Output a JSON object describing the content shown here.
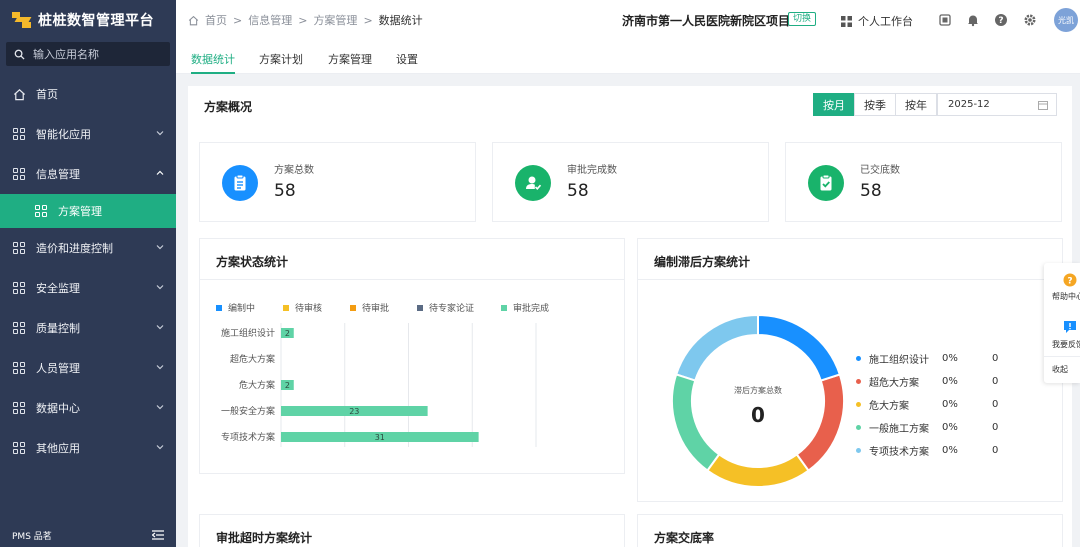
{
  "app": {
    "title": "桩桩数智管理平台",
    "footer_brand": "PMS 品茗"
  },
  "search": {
    "placeholder": "输入应用名称"
  },
  "sidebar": {
    "items": [
      {
        "label": "首页",
        "icon": "home-icon"
      },
      {
        "label": "智能化应用",
        "icon": "grid-icon"
      },
      {
        "label": "信息管理",
        "icon": "grid-icon"
      },
      {
        "label": "方案管理",
        "icon": "grid-icon"
      },
      {
        "label": "造价和进度控制",
        "icon": "grid-icon"
      },
      {
        "label": "安全监理",
        "icon": "grid-icon"
      },
      {
        "label": "质量控制",
        "icon": "grid-icon"
      },
      {
        "label": "人员管理",
        "icon": "grid-icon"
      },
      {
        "label": "数据中心",
        "icon": "grid-icon"
      },
      {
        "label": "其他应用",
        "icon": "grid-icon"
      }
    ]
  },
  "breadcrumb": [
    "首页",
    "信息管理",
    "方案管理",
    "数据统计"
  ],
  "header": {
    "project": "济南市第一人民医院新院区项目",
    "switch": "切换",
    "workbench": "个人工作台",
    "avatar": "光凯"
  },
  "tabs": [
    "数据统计",
    "方案计划",
    "方案管理",
    "设置"
  ],
  "overview": {
    "title": "方案概况",
    "periods": [
      "按月",
      "按季",
      "按年"
    ],
    "date": "2025-12",
    "cards": [
      {
        "label": "方案总数",
        "value": "58",
        "color": "#1890ff",
        "icon": "clipboard-icon"
      },
      {
        "label": "审批完成数",
        "value": "58",
        "color": "#19b36b",
        "icon": "approve-icon"
      },
      {
        "label": "已交底数",
        "value": "58",
        "color": "#19b36b",
        "icon": "checklist-icon"
      }
    ]
  },
  "status_panel": {
    "title": "方案状态统计",
    "legend": [
      {
        "name": "编制中",
        "color": "#1890ff"
      },
      {
        "name": "待审核",
        "color": "#f5c026"
      },
      {
        "name": "待审批",
        "color": "#f39c12"
      },
      {
        "name": "待专家论证",
        "color": "#5b6b84"
      },
      {
        "name": "审批完成",
        "color": "#5fd3a6"
      }
    ]
  },
  "delay_panel": {
    "title": "编制滞后方案统计",
    "center_label": "滞后方案总数",
    "center_value": "0",
    "rows": [
      {
        "name": "施工组织设计",
        "pct": "0%",
        "count": "0",
        "color": "#1890ff"
      },
      {
        "name": "超危大方案",
        "pct": "0%",
        "count": "0",
        "color": "#e8604c"
      },
      {
        "name": "危大方案",
        "pct": "0%",
        "count": "0",
        "color": "#f5c026"
      },
      {
        "name": "一般施工方案",
        "pct": "0%",
        "count": "0",
        "color": "#5fd3a6"
      },
      {
        "name": "专项技术方案",
        "pct": "0%",
        "count": "0",
        "color": "#7ec8ee"
      }
    ]
  },
  "bottom": {
    "left_title": "审批超时方案统计",
    "right_title": "方案交底率"
  },
  "float": {
    "help": "帮助中心",
    "feedback": "我要反馈",
    "collapse": "收起"
  },
  "chart_data": [
    {
      "type": "bar",
      "orientation": "horizontal",
      "categories": [
        "施工组织设计",
        "超危大方案",
        "危大方案",
        "一般安全方案",
        "专项技术方案"
      ],
      "series": [
        {
          "name": "编制中",
          "values": [
            0,
            0,
            0,
            0,
            0
          ]
        },
        {
          "name": "待审核",
          "values": [
            0,
            0,
            0,
            0,
            0
          ]
        },
        {
          "name": "待审批",
          "values": [
            0,
            0,
            0,
            0,
            0
          ]
        },
        {
          "name": "待专家论证",
          "values": [
            0,
            0,
            0,
            0,
            0
          ]
        },
        {
          "name": "审批完成",
          "values": [
            2,
            0,
            2,
            23,
            31
          ]
        }
      ],
      "xlim": [
        0,
        40
      ],
      "grid": true,
      "legend_position": "top"
    },
    {
      "type": "pie",
      "labels": [
        "施工组织设计",
        "超危大方案",
        "危大方案",
        "一般施工方案",
        "专项技术方案"
      ],
      "values": [
        0,
        0,
        0,
        0,
        0
      ]
    }
  ]
}
